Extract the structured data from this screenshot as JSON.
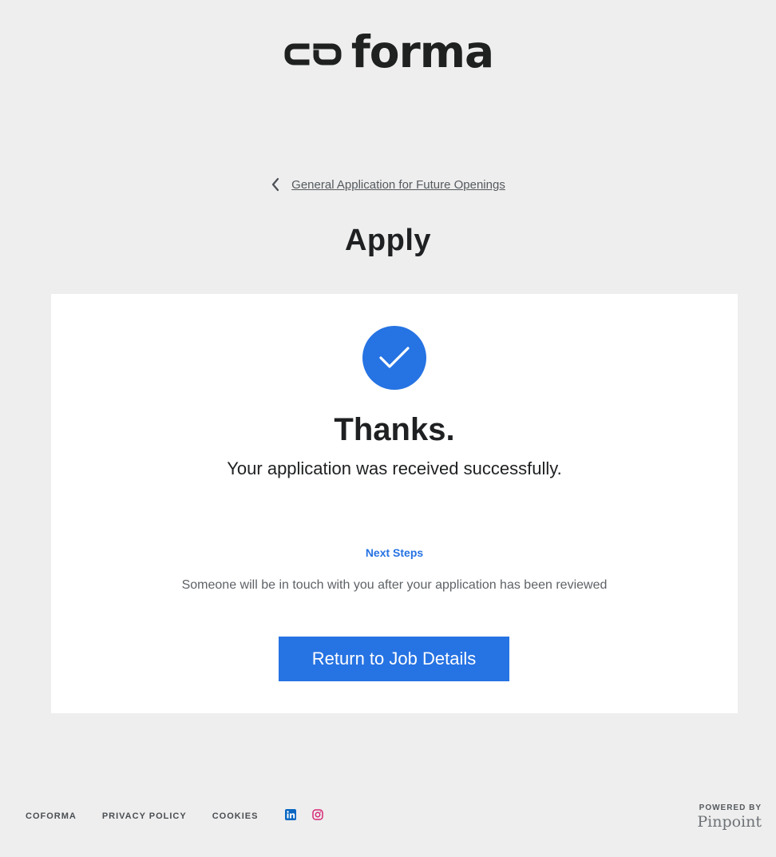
{
  "brand": {
    "logo_text": "coforma"
  },
  "nav": {
    "back_label": "General Application for Future Openings"
  },
  "page": {
    "title": "Apply"
  },
  "confirmation": {
    "heading": "Thanks.",
    "message": "Your application was received successfully.",
    "next_steps_title": "Next Steps",
    "next_steps_body": "Someone will be in touch with you after your application has been reviewed",
    "button_label": "Return to Job Details"
  },
  "footer": {
    "links": [
      "COFORMA",
      "PRIVACY POLICY",
      "COOKIES"
    ],
    "social_icons": [
      "linkedin-icon",
      "instagram-icon"
    ],
    "powered_by": "POWERED BY",
    "powered_brand": "Pinpoint"
  },
  "colors": {
    "accent": "#2673e3",
    "background": "#eeeeee",
    "card": "#ffffff",
    "linkedin": "#0a66c2",
    "instagram": "#d62976"
  }
}
